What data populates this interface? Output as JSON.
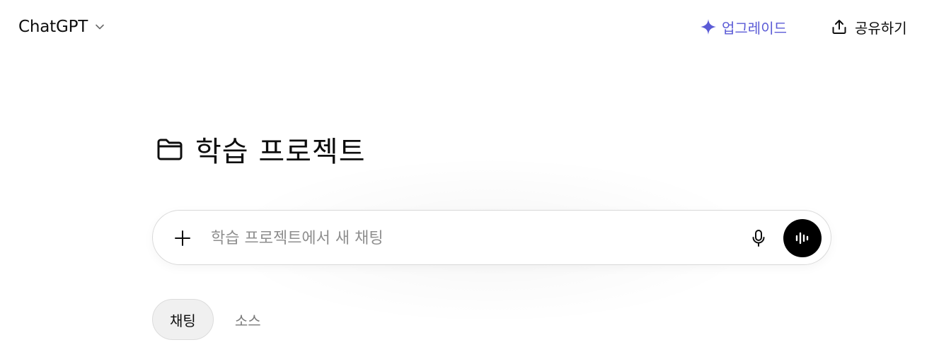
{
  "header": {
    "model_name": "ChatGPT",
    "model_chevron_icon": "chevron-down-icon",
    "upgrade_label": "업그레이드",
    "upgrade_icon": "sparkle-icon",
    "share_label": "공유하기",
    "share_icon": "share-upload-icon"
  },
  "project": {
    "title": "학습 프로젝트",
    "icon": "folder-icon"
  },
  "composer": {
    "placeholder": "학습 프로젝트에서 새 채팅",
    "value": "",
    "add_icon": "plus-icon",
    "mic_icon": "microphone-icon",
    "voice_icon": "voice-mode-icon"
  },
  "tabs": [
    {
      "label": "채팅",
      "active": true
    },
    {
      "label": "소스",
      "active": false
    }
  ],
  "colors": {
    "accent": "#5b5bd6",
    "text": "#0d0d0d",
    "placeholder": "#8e8e8e",
    "voice_button": "#000000"
  }
}
